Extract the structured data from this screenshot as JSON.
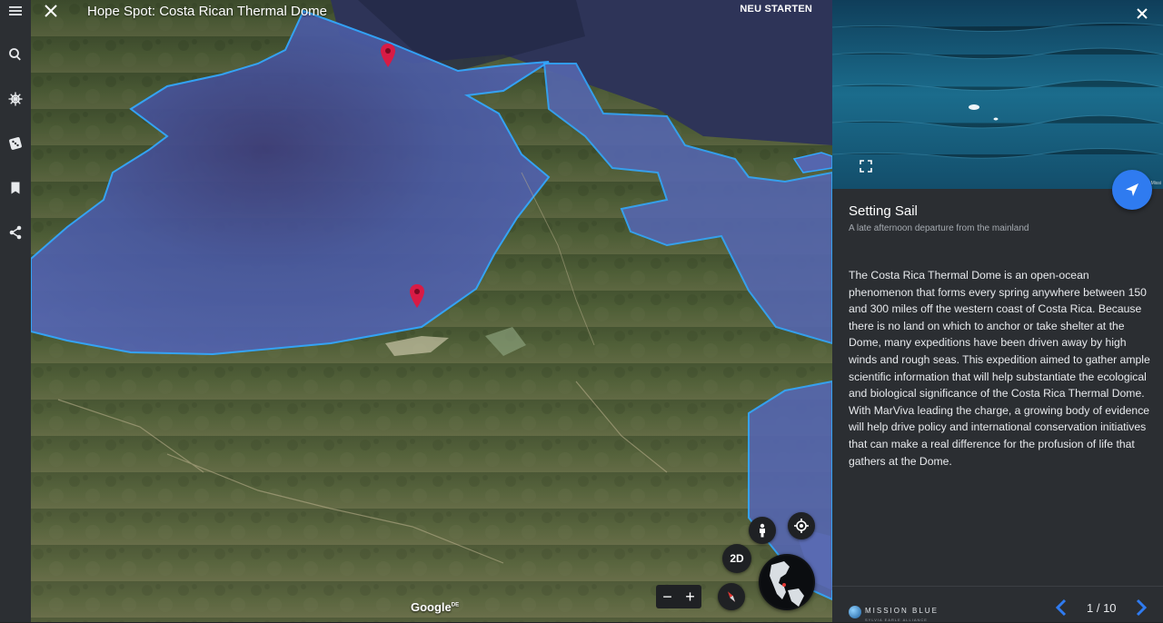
{
  "window": {
    "title": "Hope Spot: Costa Rican Thermal Dome"
  },
  "toolbar": {
    "restart_label": "NEU STARTEN"
  },
  "rail": {
    "items": [
      {
        "name": "menu",
        "icon": "hamburger-menu-icon"
      },
      {
        "name": "search",
        "icon": "search-icon"
      },
      {
        "name": "voyager",
        "icon": "ship-wheel-icon"
      },
      {
        "name": "feeling-lucky",
        "icon": "dice-icon"
      },
      {
        "name": "projects",
        "icon": "bookmark-icon"
      },
      {
        "name": "share",
        "icon": "share-icon"
      }
    ]
  },
  "map": {
    "controls": {
      "view_2d_label": "2D",
      "zoom_out": "−",
      "zoom_in": "+"
    },
    "attribution": "Google",
    "attribution_region": "DE",
    "colors": {
      "ocean_overlay": "#4f5fa8",
      "outline": "#33a7ff",
      "pin": "#d81b45"
    }
  },
  "panel": {
    "slide": {
      "title": "Setting Sail",
      "subtitle": "A late afternoon departure from the mainland",
      "body": "The Costa Rica Thermal Dome is an open-ocean phenomenon that forms every spring anywhere between 150 and 300 miles off the western coast of Costa Rica. Because there is no land on which to anchor or take shelter at the Dome, many expeditions have been driven away by high winds and rough seas. This expedition aimed to gather ample scientific information that will help substantiate the ecological and biological significance of the Costa Rica Thermal Dome. With MarViva leading the charge, a growing body of evidence will help drive policy and international conservation initiatives that can make a real difference for the profusion of life that gathers at the Dome."
    },
    "photo_credit": "Missi",
    "footer": {
      "logo_text": "MISSION BLUE",
      "logo_sub": "SYLVIA EARLE ALLIANCE",
      "counter": "1 / 10"
    },
    "accent_color": "#2f7bf0"
  }
}
